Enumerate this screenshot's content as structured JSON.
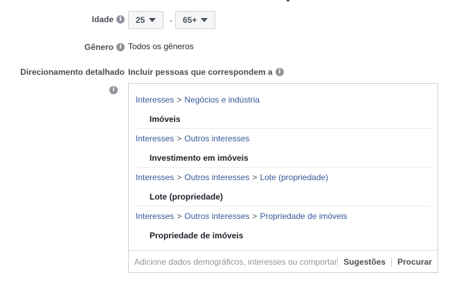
{
  "age": {
    "label": "Idade",
    "min_value": "25",
    "max_value": "65+",
    "separator": "-"
  },
  "gender": {
    "label": "Gênero",
    "value": "Todos os gêneros"
  },
  "detailed_targeting": {
    "label": "Direcionamento detalhado",
    "include_text": "Incluir pessoas que correspondem a",
    "groups": [
      {
        "path": [
          "Interesses",
          "Negócios e indústria"
        ],
        "item": "Imóveis"
      },
      {
        "path": [
          "Interesses",
          "Outros interesses"
        ],
        "item": "Investimento em imóveis"
      },
      {
        "path": [
          "Interesses",
          "Outros interesses",
          "Lote (propriedade)"
        ],
        "item": "Lote (propriedade)"
      },
      {
        "path": [
          "Interesses",
          "Outros interesses",
          "Propriedade de imóveis"
        ],
        "item": "Propriedade de imóveis"
      }
    ],
    "path_separator": ">",
    "search_placeholder": "Adicione dados demográficos, interesses ou comportar",
    "suggestions_label": "Sugestões",
    "browse_label": "Procurar"
  },
  "icons": {
    "info": "info-icon",
    "dropdown": "caret-down-icon"
  },
  "colors": {
    "link": "#365899",
    "label": "#4b4f56",
    "border": "#ccd0d5"
  }
}
